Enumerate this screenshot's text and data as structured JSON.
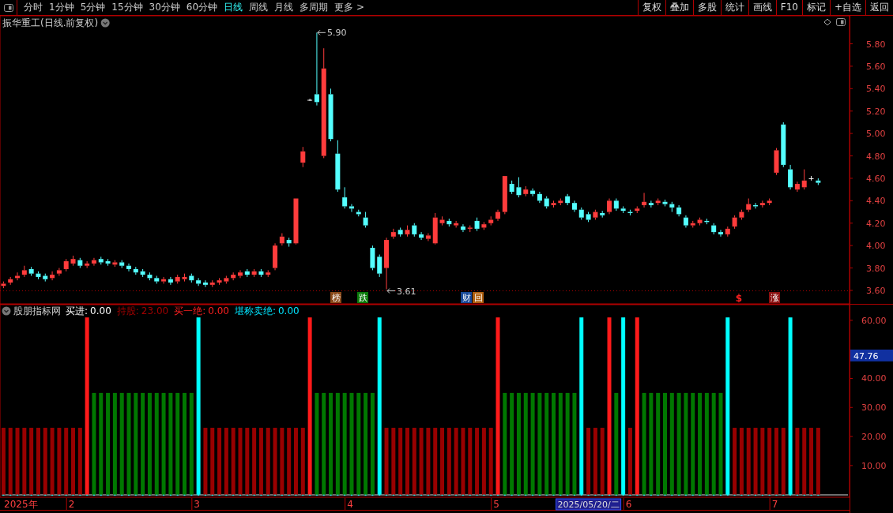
{
  "toolbar": {
    "periods": [
      {
        "label": "分时",
        "selected": false
      },
      {
        "label": "1分钟",
        "selected": false
      },
      {
        "label": "5分钟",
        "selected": false
      },
      {
        "label": "15分钟",
        "selected": false
      },
      {
        "label": "30分钟",
        "selected": false
      },
      {
        "label": "60分钟",
        "selected": false
      },
      {
        "label": "日线",
        "selected": true
      },
      {
        "label": "周线",
        "selected": false
      },
      {
        "label": "月线",
        "selected": false
      },
      {
        "label": "多周期",
        "selected": false
      },
      {
        "label": "更多 >",
        "selected": false
      }
    ],
    "buttons": [
      "复权",
      "叠加",
      "多股",
      "统计",
      "画线",
      "F10",
      "标记",
      "+自选",
      "返回"
    ]
  },
  "price_panel": {
    "title": "振华重工(日线.前复权)",
    "high_label": "5.90",
    "low_label": "3.61",
    "events": [
      {
        "kind": "tag",
        "text": "榜",
        "color": "#8b4a1a"
      },
      {
        "kind": "tag",
        "text": "跌",
        "color": "#0a7a0a"
      },
      {
        "kind": "tag",
        "text": "财",
        "color": "#1a4a9a"
      },
      {
        "kind": "tag",
        "text": "回",
        "color": "#b06010"
      },
      {
        "kind": "sign",
        "text": "$",
        "color": "#ff2020"
      },
      {
        "kind": "tag",
        "text": "涨",
        "color": "#8b1010"
      }
    ],
    "chart_data": {
      "type": "candlestick",
      "ylim": [
        3.48,
        6.05
      ],
      "yticks": [
        {
          "value": 3.6,
          "label": "3.60"
        },
        {
          "value": 3.8,
          "label": "3.80"
        },
        {
          "value": 4.0,
          "label": "4.00"
        },
        {
          "value": 4.2,
          "label": "4.20"
        },
        {
          "value": 4.4,
          "label": "4.40"
        },
        {
          "value": 4.6,
          "label": "4.60"
        },
        {
          "value": 4.8,
          "label": "4.80"
        },
        {
          "value": 5.0,
          "label": "5.00"
        },
        {
          "value": 5.2,
          "label": "5.20"
        },
        {
          "value": 5.4,
          "label": "5.40"
        },
        {
          "value": 5.6,
          "label": "5.60"
        },
        {
          "value": 5.8,
          "label": "5.80"
        }
      ],
      "categories": [
        null,
        null,
        null,
        null,
        null,
        null,
        null,
        null,
        null,
        null,
        null,
        null,
        null,
        null,
        null,
        null,
        null,
        null,
        null,
        null,
        null,
        null,
        null,
        null,
        null,
        null,
        null,
        null,
        null,
        null,
        null,
        null,
        null,
        null,
        null,
        null,
        null,
        null,
        null,
        null,
        null,
        null,
        null,
        null,
        null,
        null,
        null,
        null,
        null,
        null,
        null,
        null,
        null,
        null,
        null,
        null,
        null,
        null,
        null,
        null,
        null,
        null,
        null,
        null,
        null,
        null,
        null,
        null,
        null,
        null,
        null,
        null,
        null,
        null,
        null,
        null,
        null,
        null,
        null,
        null,
        null,
        null,
        null,
        null,
        null,
        null,
        null,
        null,
        null,
        null,
        null,
        null,
        null,
        null,
        null,
        null,
        null,
        null,
        null,
        null,
        null,
        null,
        null,
        null,
        null,
        null,
        null,
        null,
        null,
        null,
        null,
        null,
        null,
        null,
        null,
        null,
        null,
        null
      ],
      "ohlc": [
        [
          3.64,
          3.68,
          3.62,
          3.66
        ],
        [
          3.67,
          3.72,
          3.65,
          3.7
        ],
        [
          3.71,
          3.76,
          3.69,
          3.73
        ],
        [
          3.74,
          3.82,
          3.72,
          3.78
        ],
        [
          3.79,
          3.81,
          3.73,
          3.75
        ],
        [
          3.75,
          3.77,
          3.7,
          3.72
        ],
        [
          3.73,
          3.75,
          3.68,
          3.7
        ],
        [
          3.71,
          3.77,
          3.69,
          3.74
        ],
        [
          3.75,
          3.8,
          3.73,
          3.78
        ],
        [
          3.79,
          3.88,
          3.77,
          3.86
        ],
        [
          3.84,
          3.91,
          3.82,
          3.88
        ],
        [
          3.87,
          3.89,
          3.8,
          3.82
        ],
        [
          3.82,
          3.86,
          3.8,
          3.84
        ],
        [
          3.84,
          3.89,
          3.82,
          3.87
        ],
        [
          3.88,
          3.9,
          3.83,
          3.85
        ],
        [
          3.86,
          3.88,
          3.82,
          3.84
        ],
        [
          3.83,
          3.87,
          3.81,
          3.85
        ],
        [
          3.85,
          3.87,
          3.8,
          3.82
        ],
        [
          3.82,
          3.84,
          3.77,
          3.79
        ],
        [
          3.79,
          3.81,
          3.74,
          3.76
        ],
        [
          3.77,
          3.79,
          3.72,
          3.74
        ],
        [
          3.74,
          3.76,
          3.69,
          3.71
        ],
        [
          3.71,
          3.73,
          3.66,
          3.68
        ],
        [
          3.68,
          3.72,
          3.66,
          3.7
        ],
        [
          3.7,
          3.72,
          3.65,
          3.67
        ],
        [
          3.68,
          3.74,
          3.66,
          3.72
        ],
        [
          3.7,
          3.75,
          3.68,
          3.72
        ],
        [
          3.73,
          3.75,
          3.67,
          3.69
        ],
        [
          3.69,
          3.71,
          3.64,
          3.66
        ],
        [
          3.67,
          3.69,
          3.63,
          3.65
        ],
        [
          3.65,
          3.69,
          3.63,
          3.67
        ],
        [
          3.67,
          3.71,
          3.65,
          3.69
        ],
        [
          3.68,
          3.73,
          3.66,
          3.71
        ],
        [
          3.71,
          3.76,
          3.69,
          3.74
        ],
        [
          3.73,
          3.78,
          3.71,
          3.76
        ],
        [
          3.77,
          3.79,
          3.72,
          3.74
        ],
        [
          3.74,
          3.79,
          3.72,
          3.77
        ],
        [
          3.77,
          3.79,
          3.72,
          3.74
        ],
        [
          3.74,
          3.78,
          3.72,
          3.76
        ],
        [
          3.8,
          4.02,
          3.78,
          4.0
        ],
        [
          4.02,
          4.11,
          4.0,
          4.08
        ],
        [
          4.05,
          4.07,
          3.99,
          4.02
        ],
        [
          4.02,
          4.42,
          4.01,
          4.42
        ],
        [
          4.74,
          4.88,
          4.7,
          4.84
        ],
        [
          5.3,
          5.31,
          5.29,
          5.3
        ],
        [
          5.35,
          5.9,
          5.25,
          5.28
        ],
        [
          4.8,
          5.76,
          4.78,
          5.58
        ],
        [
          5.35,
          5.4,
          4.93,
          4.95
        ],
        [
          4.82,
          4.94,
          4.48,
          4.5
        ],
        [
          4.43,
          4.52,
          4.33,
          4.35
        ],
        [
          4.35,
          4.37,
          4.3,
          4.33
        ],
        [
          4.3,
          4.32,
          4.26,
          4.28
        ],
        [
          4.25,
          4.3,
          4.16,
          4.18
        ],
        [
          3.98,
          4.0,
          3.78,
          3.8
        ],
        [
          3.9,
          3.92,
          3.72,
          3.75
        ],
        [
          3.8,
          4.07,
          3.61,
          4.05
        ],
        [
          4.08,
          4.15,
          4.06,
          4.12
        ],
        [
          4.14,
          4.16,
          4.08,
          4.1
        ],
        [
          4.1,
          4.18,
          4.08,
          4.14
        ],
        [
          4.18,
          4.2,
          4.08,
          4.1
        ],
        [
          4.1,
          4.12,
          4.05,
          4.07
        ],
        [
          4.06,
          4.11,
          4.04,
          4.09
        ],
        [
          4.02,
          4.29,
          4.01,
          4.25
        ],
        [
          4.2,
          4.26,
          4.18,
          4.23
        ],
        [
          4.22,
          4.24,
          4.17,
          4.19
        ],
        [
          4.18,
          4.22,
          4.16,
          4.2
        ],
        [
          4.17,
          4.19,
          4.12,
          4.14
        ],
        [
          4.15,
          4.18,
          4.12,
          4.16
        ],
        [
          4.22,
          4.25,
          4.13,
          4.15
        ],
        [
          4.16,
          4.21,
          4.14,
          4.19
        ],
        [
          4.2,
          4.26,
          4.18,
          4.23
        ],
        [
          4.24,
          4.32,
          4.22,
          4.3
        ],
        [
          4.3,
          4.62,
          4.28,
          4.62
        ],
        [
          4.55,
          4.58,
          4.46,
          4.48
        ],
        [
          4.52,
          4.61,
          4.43,
          4.45
        ],
        [
          4.46,
          4.53,
          4.44,
          4.5
        ],
        [
          4.49,
          4.51,
          4.44,
          4.46
        ],
        [
          4.46,
          4.48,
          4.38,
          4.4
        ],
        [
          4.42,
          4.44,
          4.33,
          4.35
        ],
        [
          4.36,
          4.4,
          4.34,
          4.38
        ],
        [
          4.38,
          4.42,
          4.36,
          4.4
        ],
        [
          4.44,
          4.46,
          4.36,
          4.38
        ],
        [
          4.38,
          4.4,
          4.3,
          4.32
        ],
        [
          4.32,
          4.34,
          4.23,
          4.25
        ],
        [
          4.28,
          4.3,
          4.21,
          4.23
        ],
        [
          4.25,
          4.32,
          4.23,
          4.3
        ],
        [
          4.29,
          4.31,
          4.25,
          4.27
        ],
        [
          4.3,
          4.42,
          4.28,
          4.4
        ],
        [
          4.4,
          4.42,
          4.31,
          4.33
        ],
        [
          4.33,
          4.35,
          4.29,
          4.31
        ],
        [
          4.3,
          4.32,
          4.27,
          4.29
        ],
        [
          4.31,
          4.35,
          4.29,
          4.33
        ],
        [
          4.36,
          4.47,
          4.34,
          4.39
        ],
        [
          4.38,
          4.4,
          4.34,
          4.36
        ],
        [
          4.38,
          4.42,
          4.36,
          4.4
        ],
        [
          4.39,
          4.41,
          4.35,
          4.37
        ],
        [
          4.37,
          4.39,
          4.3,
          4.34
        ],
        [
          4.34,
          4.36,
          4.26,
          4.28
        ],
        [
          4.25,
          4.27,
          4.16,
          4.18
        ],
        [
          4.18,
          4.22,
          4.16,
          4.2
        ],
        [
          4.2,
          4.25,
          4.18,
          4.23
        ],
        [
          4.22,
          4.24,
          4.19,
          4.21
        ],
        [
          4.18,
          4.2,
          4.1,
          4.12
        ],
        [
          4.12,
          4.14,
          4.08,
          4.1
        ],
        [
          4.1,
          4.17,
          4.08,
          4.15
        ],
        [
          4.17,
          4.27,
          4.15,
          4.25
        ],
        [
          4.25,
          4.32,
          4.23,
          4.3
        ],
        [
          4.32,
          4.42,
          4.3,
          4.37
        ],
        [
          4.36,
          4.38,
          4.33,
          4.35
        ],
        [
          4.36,
          4.4,
          4.34,
          4.38
        ],
        [
          4.38,
          4.42,
          4.36,
          4.4
        ],
        [
          4.65,
          4.87,
          4.63,
          4.85
        ],
        [
          5.08,
          5.1,
          4.7,
          4.72
        ],
        [
          4.68,
          4.72,
          4.5,
          4.52
        ],
        [
          4.5,
          4.57,
          4.48,
          4.55
        ],
        [
          4.52,
          4.68,
          4.5,
          4.58
        ],
        [
          4.6,
          4.62,
          4.58,
          4.6
        ],
        [
          4.58,
          4.6,
          4.54,
          4.56
        ]
      ]
    }
  },
  "indicator_panel": {
    "name": "股朋指标网",
    "legend": [
      {
        "label": "买进:",
        "value": "0.00",
        "color": "#ffffff"
      },
      {
        "label": "持股:",
        "value": "23.00",
        "color": "#a00000"
      },
      {
        "label": "买一绝:",
        "value": "0.00",
        "color": "#ff2020"
      },
      {
        "label": "堪称卖绝:",
        "value": "0.00",
        "color": "#00e5ff"
      }
    ],
    "current_value": "47.76",
    "chart_data": {
      "type": "bar",
      "ylim": [
        -0.9,
        65.4
      ],
      "yticks": [
        {
          "value": 10,
          "label": "10.00"
        },
        {
          "value": 20,
          "label": "20.00"
        },
        {
          "value": 30,
          "label": "30.00"
        },
        {
          "value": 40,
          "label": "40.00"
        },
        {
          "value": 60,
          "label": "60.00"
        }
      ],
      "categories": [
        null,
        null,
        null,
        null,
        null,
        null,
        null,
        null,
        null,
        null,
        null,
        null,
        null,
        null,
        null,
        null,
        null,
        null,
        null,
        null,
        null,
        null,
        null,
        null,
        null,
        null,
        null,
        null,
        null,
        null,
        null,
        null,
        null,
        null,
        null,
        null,
        null,
        null,
        null,
        null,
        null,
        null,
        null,
        null,
        null,
        null,
        null,
        null,
        null,
        null,
        null,
        null,
        null,
        null,
        null,
        null,
        null,
        null,
        null,
        null,
        null,
        null,
        null,
        null,
        null,
        null,
        null,
        null,
        null,
        null,
        null,
        null,
        null,
        null,
        null,
        null,
        null,
        null,
        null,
        null,
        null,
        null,
        null,
        null,
        null,
        null,
        null,
        null,
        null,
        null,
        null,
        null,
        null,
        null,
        null,
        null,
        null,
        null,
        null,
        null,
        null,
        null,
        null,
        null,
        null,
        null,
        null,
        null,
        null,
        null,
        null,
        null,
        null,
        null,
        null,
        null,
        null,
        null
      ],
      "series": [
        {
          "color": "#990000",
          "values": [
            23,
            23,
            23,
            23,
            23,
            23,
            23,
            23,
            23,
            23,
            23,
            23,
            null,
            null,
            null,
            null,
            null,
            null,
            null,
            null,
            null,
            null,
            null,
            null,
            null,
            null,
            null,
            null,
            null,
            23,
            23,
            23,
            23,
            23,
            23,
            23,
            23,
            23,
            23,
            23,
            23,
            23,
            23,
            23,
            null,
            null,
            null,
            null,
            null,
            null,
            null,
            null,
            null,
            null,
            null,
            23,
            23,
            23,
            23,
            23,
            23,
            23,
            23,
            23,
            23,
            23,
            23,
            23,
            23,
            23,
            23,
            null,
            null,
            null,
            null,
            null,
            null,
            null,
            null,
            null,
            null,
            null,
            null,
            null,
            23,
            23,
            23,
            null,
            null,
            null,
            23,
            null,
            null,
            null,
            null,
            null,
            null,
            null,
            null,
            null,
            null,
            null,
            null,
            null,
            null,
            23,
            23,
            23,
            23,
            23,
            23,
            23,
            23,
            null,
            23,
            23,
            23,
            23
          ]
        },
        {
          "color": "#007800",
          "values": [
            null,
            null,
            null,
            null,
            null,
            null,
            null,
            null,
            null,
            null,
            null,
            null,
            null,
            35,
            35,
            35,
            35,
            35,
            35,
            35,
            35,
            35,
            35,
            35,
            35,
            35,
            35,
            35,
            null,
            null,
            null,
            null,
            null,
            null,
            null,
            null,
            null,
            null,
            null,
            null,
            null,
            null,
            null,
            null,
            null,
            35,
            35,
            35,
            35,
            35,
            35,
            35,
            35,
            35,
            null,
            null,
            null,
            null,
            null,
            null,
            null,
            null,
            null,
            null,
            null,
            null,
            null,
            null,
            null,
            null,
            null,
            null,
            35,
            35,
            35,
            35,
            35,
            35,
            35,
            35,
            35,
            35,
            35,
            null,
            null,
            null,
            null,
            null,
            35,
            null,
            null,
            null,
            35,
            35,
            35,
            35,
            35,
            35,
            35,
            35,
            35,
            35,
            35,
            35,
            null,
            null,
            null,
            null,
            null,
            null,
            null,
            null,
            null,
            null,
            null,
            null,
            null,
            null
          ]
        },
        {
          "color": "#ff1a1a",
          "values": [
            null,
            null,
            null,
            null,
            null,
            null,
            null,
            null,
            null,
            null,
            null,
            null,
            61,
            null,
            null,
            null,
            null,
            null,
            null,
            null,
            null,
            null,
            null,
            null,
            null,
            null,
            null,
            null,
            null,
            null,
            null,
            null,
            null,
            null,
            null,
            null,
            null,
            null,
            null,
            null,
            null,
            null,
            null,
            null,
            61,
            null,
            null,
            null,
            null,
            null,
            null,
            null,
            null,
            null,
            null,
            null,
            null,
            null,
            null,
            null,
            null,
            null,
            null,
            null,
            null,
            null,
            null,
            null,
            null,
            null,
            null,
            61,
            null,
            null,
            null,
            null,
            null,
            null,
            null,
            null,
            null,
            null,
            null,
            null,
            null,
            null,
            null,
            61,
            null,
            null,
            null,
            61,
            null,
            null,
            null,
            null,
            null,
            null,
            null,
            null,
            null,
            null,
            null,
            null,
            null,
            null,
            null,
            null,
            null,
            null,
            null,
            null,
            null,
            null,
            null,
            null,
            null,
            null
          ]
        },
        {
          "color": "#00ffff",
          "values": [
            null,
            null,
            null,
            null,
            null,
            null,
            null,
            null,
            null,
            null,
            null,
            null,
            null,
            null,
            null,
            null,
            null,
            null,
            null,
            null,
            null,
            null,
            null,
            null,
            null,
            null,
            null,
            null,
            61,
            null,
            null,
            null,
            null,
            null,
            null,
            null,
            null,
            null,
            null,
            null,
            null,
            null,
            null,
            null,
            null,
            null,
            null,
            null,
            null,
            null,
            null,
            null,
            null,
            null,
            61,
            null,
            null,
            null,
            null,
            null,
            null,
            null,
            null,
            null,
            null,
            null,
            null,
            null,
            null,
            null,
            null,
            null,
            null,
            null,
            null,
            null,
            null,
            null,
            null,
            null,
            null,
            null,
            null,
            61,
            null,
            null,
            null,
            null,
            null,
            61,
            null,
            null,
            null,
            null,
            null,
            null,
            null,
            null,
            null,
            null,
            null,
            null,
            null,
            null,
            61,
            null,
            null,
            null,
            null,
            null,
            null,
            null,
            null,
            61,
            null,
            null,
            null,
            null
          ]
        }
      ]
    }
  },
  "time_axis": {
    "labels": [
      "2025年",
      "2",
      "3",
      "4",
      "5",
      "6",
      "7"
    ],
    "cursor_label": "2025/05/20/二"
  }
}
